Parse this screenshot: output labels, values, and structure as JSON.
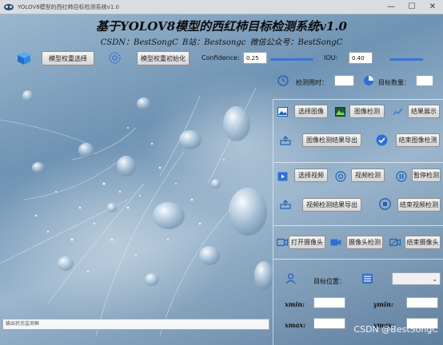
{
  "window": {
    "title": "YOLOV8模型的西红柿目标检测系统v1.0",
    "controls": {
      "minimize": "—",
      "maximize": "☐",
      "close": "✕"
    }
  },
  "header": {
    "title": "基于YOLOV8模型的西红柿目标检测系统v1.0",
    "subtitle": "CSDN：BestSongC  B站：Bestsongc  微信公众号：BestSongC"
  },
  "top_bar": {
    "model_select_label": "模型权重选择",
    "model_init_label": "模型权重初始化",
    "confidence_label": "Confidence:",
    "confidence_value": "0.25",
    "iou_label": "IOU:",
    "iou_value": "0.40"
  },
  "stats": {
    "time_label": "检测用时：",
    "time_value": "",
    "count_label": "目标数量：",
    "count_value": ""
  },
  "image_section": {
    "select_image": "选择图像",
    "detect_image": "图像检测",
    "show_result": "结果展示",
    "export_result": "图像检测结果导出",
    "stop_image": "结束图像检测"
  },
  "video_section": {
    "select_video": "选择视频",
    "detect_video": "视频检测",
    "pause_detect": "暂停检测",
    "export_video": "视频检测结果导出",
    "stop_video": "结束视频检测"
  },
  "camera_section": {
    "open_camera": "打开摄像头",
    "detect_camera": "摄像头检测",
    "close_camera": "结束摄像头"
  },
  "target_section": {
    "position_label": "目标位置：",
    "xmin_label": "xmin:",
    "ymin_label": "ymin:",
    "xmax_label": "xmax:",
    "ymax_label": "ymax:",
    "xmin_value": "",
    "ymin_value": "",
    "xmax_value": "",
    "ymax_value": "",
    "selected_target": ""
  },
  "status": {
    "placeholder": "输出状态监测框"
  },
  "watermark": "CSDN @BestSongC",
  "colors": {
    "accent_blue": "#2f6fd6",
    "button_face": "#e6e6e6",
    "panel_line": "#e8eef4"
  },
  "icons": [
    "cube-icon",
    "gear-icon",
    "clock-icon",
    "pie-chart-icon",
    "image-icon",
    "image-detect-icon",
    "chart-icon",
    "export-icon",
    "check-circle-icon",
    "video-icon",
    "target-icon",
    "pause-icon",
    "stop-icon",
    "camera-icon",
    "user-icon",
    "list-icon"
  ]
}
